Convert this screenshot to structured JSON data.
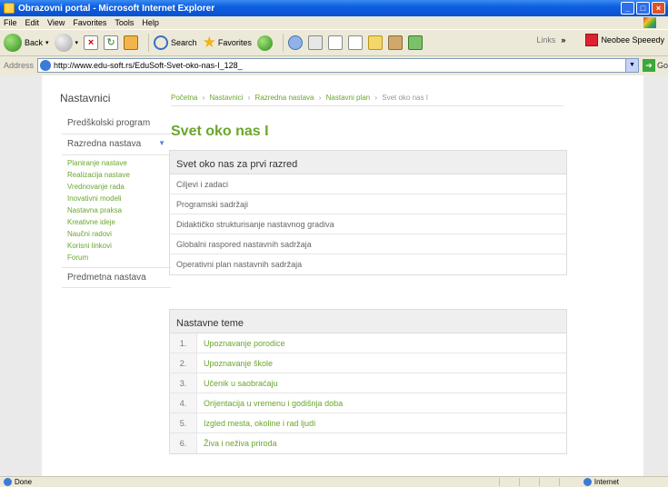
{
  "window": {
    "title": "Obrazovni portal - Microsoft Internet Explorer",
    "controls": [
      "_",
      "□",
      "×"
    ]
  },
  "menubar": {
    "items": [
      "File",
      "Edit",
      "View",
      "Favorites",
      "Tools",
      "Help"
    ]
  },
  "toolbar": {
    "back_label": "Back",
    "search_label": "Search",
    "favorites_label": "Favorites",
    "links_label": "Links",
    "chevron": "»",
    "bookmark_label": "Neobee Speeedy"
  },
  "addressbar": {
    "label": "Address",
    "url": "http://www.edu-soft.rs/EduSoft-Svet-oko-nas-I_128_",
    "go_label": "Go"
  },
  "sidebar": {
    "title": "Nastavnici",
    "items": [
      {
        "label": "Predškolski program"
      },
      {
        "label": "Razredna nastava",
        "caret": "▼"
      },
      {
        "label": "Predmetna nastava"
      }
    ],
    "subitems": [
      "Planiranje nastave",
      "Realizacija nastave",
      "Vrednovanje rada",
      "Inovativni modeli",
      "Nastavna praksa",
      "Kreativne ideje",
      "Naučni radovi",
      "Korisni linkovi",
      "Forum"
    ]
  },
  "breadcrumb": {
    "items": [
      "Početna",
      "Nastavnici",
      "Razredna nastava",
      "Nastavni plan"
    ],
    "current": "Svet oko nas I",
    "separator": "›"
  },
  "page_title": "Svet oko nas I",
  "section1": {
    "heading": "Svet oko nas za prvi razred",
    "rows": [
      "Ciljevi i zadaci",
      "Programski sadržaji",
      "Didaktičko strukturisanje nastavnog gradiva",
      "Globalni raspored nastavnih sadržaja",
      "Operativni plan nastavnih sadržaja"
    ]
  },
  "section2": {
    "heading": "Nastavne teme",
    "rows": [
      {
        "num": "1.",
        "title": "Upoznavanje porodice"
      },
      {
        "num": "2.",
        "title": "Upoznavanje škole"
      },
      {
        "num": "3.",
        "title": "Učenik u saobraćaju"
      },
      {
        "num": "4.",
        "title": "Orijentacija u vremenu i godišnja doba"
      },
      {
        "num": "5.",
        "title": "Izgled mesta, okoline i rad ljudi"
      },
      {
        "num": "6.",
        "title": "Živa i neživa priroda"
      }
    ]
  },
  "statusbar": {
    "text": "Done",
    "zone": "Internet"
  },
  "colors": {
    "accent_green": "#6aa62d",
    "xp_blue": "#0f5fe0"
  }
}
